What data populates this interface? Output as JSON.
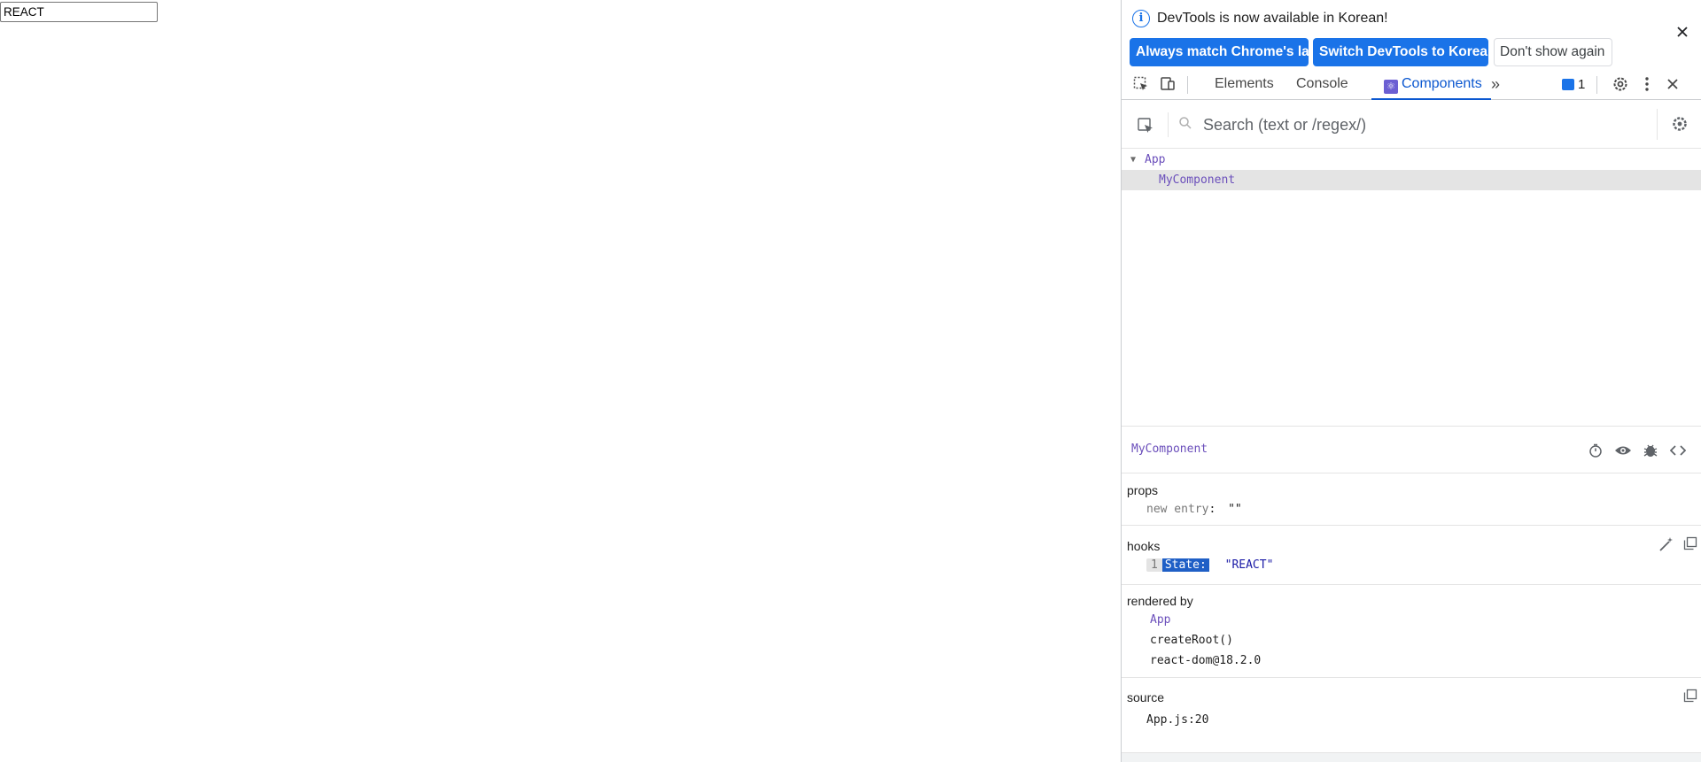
{
  "page": {
    "input_value": "REACT"
  },
  "infobar": {
    "message": "DevTools is now available in Korean!",
    "buttons": {
      "match_language": "Always match Chrome's language",
      "switch_korean": "Switch DevTools to Korean",
      "dont_show": "Don't show again"
    },
    "close_icon": "close-icon"
  },
  "toolbar": {
    "tabs": {
      "elements": "Elements",
      "console": "Console",
      "components": "Components"
    },
    "issues_count": "1",
    "icons": [
      "inspect-element-icon",
      "device-toolbar-icon",
      "more-tabs-icon",
      "settings-icon",
      "more-options-icon",
      "close-icon"
    ]
  },
  "components": {
    "search_placeholder": "Search (text or /regex/)",
    "tree": [
      {
        "name": "App",
        "expanded": true,
        "depth": 0
      },
      {
        "name": "MyComponent",
        "selected": true,
        "depth": 1
      }
    ],
    "inspected": {
      "name": "MyComponent",
      "icons": [
        "stopwatch-icon",
        "eye-icon",
        "bug-icon",
        "source-code-icon"
      ]
    },
    "props": {
      "title": "props",
      "key": "new entry",
      "colon": ":",
      "value": "\"\""
    },
    "hooks": {
      "title": "hooks",
      "index": "1",
      "name": "State:",
      "value": "\"REACT\""
    },
    "rendered_by": {
      "title": "rendered by",
      "items": [
        "App",
        "createRoot()",
        "react-dom@18.2.0"
      ]
    },
    "source": {
      "title": "source",
      "value": "App.js:20"
    }
  },
  "colors": {
    "accent": "#1a73e8",
    "active_tab": "#0b57d0",
    "component_name": "#6b4fbb",
    "selected_row": "#e4e4e4",
    "hook_highlight": "#1f5fc6"
  }
}
